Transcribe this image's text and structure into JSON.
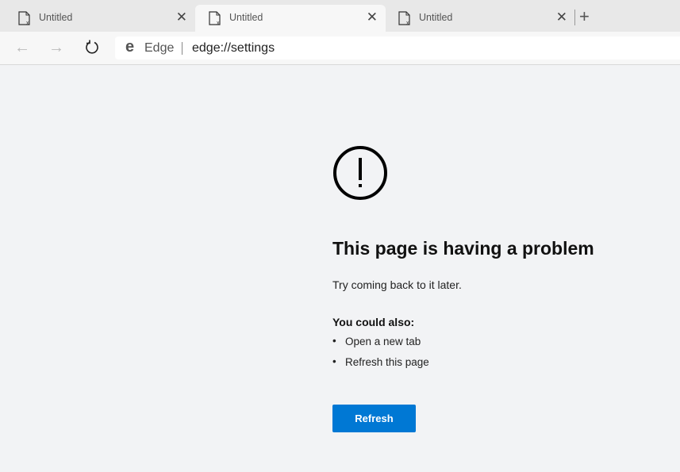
{
  "tabs": [
    {
      "title": "Untitled",
      "close": "✕",
      "active": false
    },
    {
      "title": "Untitled",
      "close": "✕",
      "active": true
    },
    {
      "title": "Untitled",
      "close": "✕",
      "active": false
    }
  ],
  "new_tab": "+",
  "toolbar": {
    "back": "←",
    "forward": "→",
    "site_icon": "e",
    "site_label": "Edge",
    "url": "edge://settings"
  },
  "error": {
    "heading": "This page is having a problem",
    "subtext": "Try coming back to it later.",
    "also_label": "You could also:",
    "suggestions": [
      "Open a new tab",
      "Refresh this page"
    ],
    "refresh_button": "Refresh"
  },
  "colors": {
    "accent": "#0078d4"
  }
}
